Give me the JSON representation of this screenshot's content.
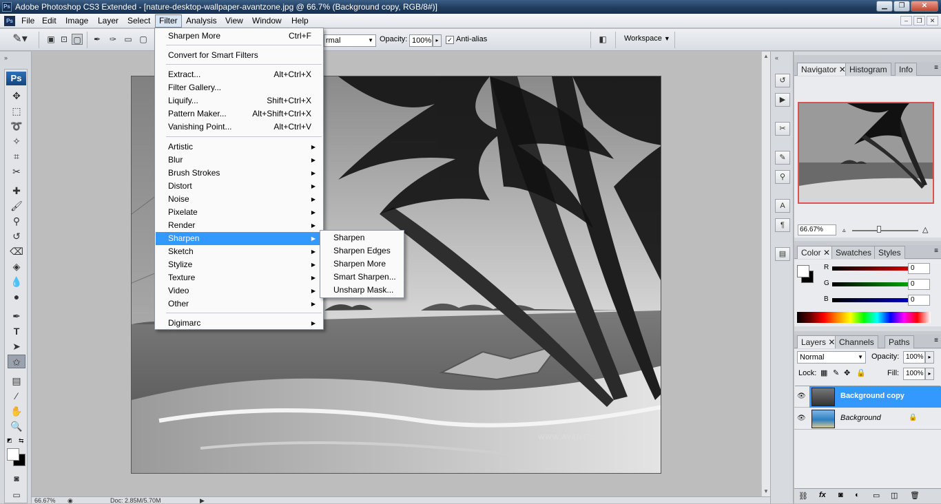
{
  "window": {
    "title": "Adobe Photoshop CS3 Extended - [nature-desktop-wallpaper-avantzone.jpg @ 66.7% (Background copy, RGB/8#)]",
    "logo": "Ps"
  },
  "menubar": {
    "items": [
      "File",
      "Edit",
      "Image",
      "Layer",
      "Select",
      "Filter",
      "Analysis",
      "View",
      "Window",
      "Help"
    ],
    "active": "Filter"
  },
  "options": {
    "mode_value": "rmal",
    "opacity_label": "Opacity:",
    "opacity_value": "100%",
    "antialias_label": "Anti-alias",
    "antialias_checked": true,
    "workspace_label": "Workspace"
  },
  "toolbox": {
    "badge": "Ps",
    "tools": [
      "move-tool",
      "marquee-tool",
      "lasso-tool",
      "magic-wand-tool",
      "crop-tool",
      "slice-tool",
      "healing-brush-tool",
      "brush-tool",
      "clone-stamp-tool",
      "history-brush-tool",
      "eraser-tool",
      "paint-bucket-tool",
      "blur-tool",
      "dodge-tool",
      "pen-tool",
      "type-tool",
      "path-selection-tool",
      "custom-shape-tool",
      "notes-tool",
      "eyedropper-tool",
      "hand-tool",
      "zoom-tool"
    ],
    "selected_tool": "custom-shape-tool"
  },
  "filter_menu": {
    "items": [
      {
        "label": "Sharpen More",
        "shortcut": "Ctrl+F"
      },
      {
        "type": "separator"
      },
      {
        "label": "Convert for Smart Filters"
      },
      {
        "type": "separator"
      },
      {
        "label": "Extract...",
        "shortcut": "Alt+Ctrl+X"
      },
      {
        "label": "Filter Gallery..."
      },
      {
        "label": "Liquify...",
        "shortcut": "Shift+Ctrl+X"
      },
      {
        "label": "Pattern Maker...",
        "shortcut": "Alt+Shift+Ctrl+X"
      },
      {
        "label": "Vanishing Point...",
        "shortcut": "Alt+Ctrl+V"
      },
      {
        "type": "separator"
      },
      {
        "label": "Artistic",
        "submenu": true
      },
      {
        "label": "Blur",
        "submenu": true
      },
      {
        "label": "Brush Strokes",
        "submenu": true
      },
      {
        "label": "Distort",
        "submenu": true
      },
      {
        "label": "Noise",
        "submenu": true
      },
      {
        "label": "Pixelate",
        "submenu": true
      },
      {
        "label": "Render",
        "submenu": true
      },
      {
        "label": "Sharpen",
        "submenu": true,
        "highlighted": true
      },
      {
        "label": "Sketch",
        "submenu": true
      },
      {
        "label": "Stylize",
        "submenu": true
      },
      {
        "label": "Texture",
        "submenu": true
      },
      {
        "label": "Video",
        "submenu": true
      },
      {
        "label": "Other",
        "submenu": true
      },
      {
        "type": "separator"
      },
      {
        "label": "Digimarc",
        "submenu": true
      }
    ]
  },
  "sharpen_submenu": {
    "items": [
      "Sharpen",
      "Sharpen Edges",
      "Sharpen More",
      "Smart Sharpen...",
      "Unsharp Mask..."
    ]
  },
  "status": {
    "zoom": "66.67%",
    "doc": "Doc: 2.85M/5.70M"
  },
  "navigator_panel": {
    "tabs": [
      "Navigator",
      "Histogram",
      "Info"
    ],
    "active_tab": "Navigator",
    "zoom": "66.67%"
  },
  "color_panel": {
    "tabs": [
      "Color",
      "Swatches",
      "Styles"
    ],
    "active_tab": "Color",
    "channels": [
      {
        "label": "R",
        "value": "0",
        "color": "#e00000"
      },
      {
        "label": "G",
        "value": "0",
        "color": "#00b000"
      },
      {
        "label": "B",
        "value": "0",
        "color": "#0000c8"
      }
    ]
  },
  "layers_panel": {
    "tabs": [
      "Layers",
      "Channels",
      "Paths"
    ],
    "active_tab": "Layers",
    "blend_mode": "Normal",
    "opacity_label": "Opacity:",
    "opacity_value": "100%",
    "lock_label": "Lock:",
    "fill_label": "Fill:",
    "fill_value": "100%",
    "layers": [
      {
        "name": "Background copy",
        "selected": true,
        "locked": false
      },
      {
        "name": "Background",
        "selected": false,
        "locked": true
      }
    ]
  },
  "canvas": {
    "watermark": "WWW.AVANTZONE.NET"
  },
  "colors": {
    "highlight": "#3399ff",
    "selected_layer": "#3399ff",
    "navigator_frame": "#d9534f"
  }
}
